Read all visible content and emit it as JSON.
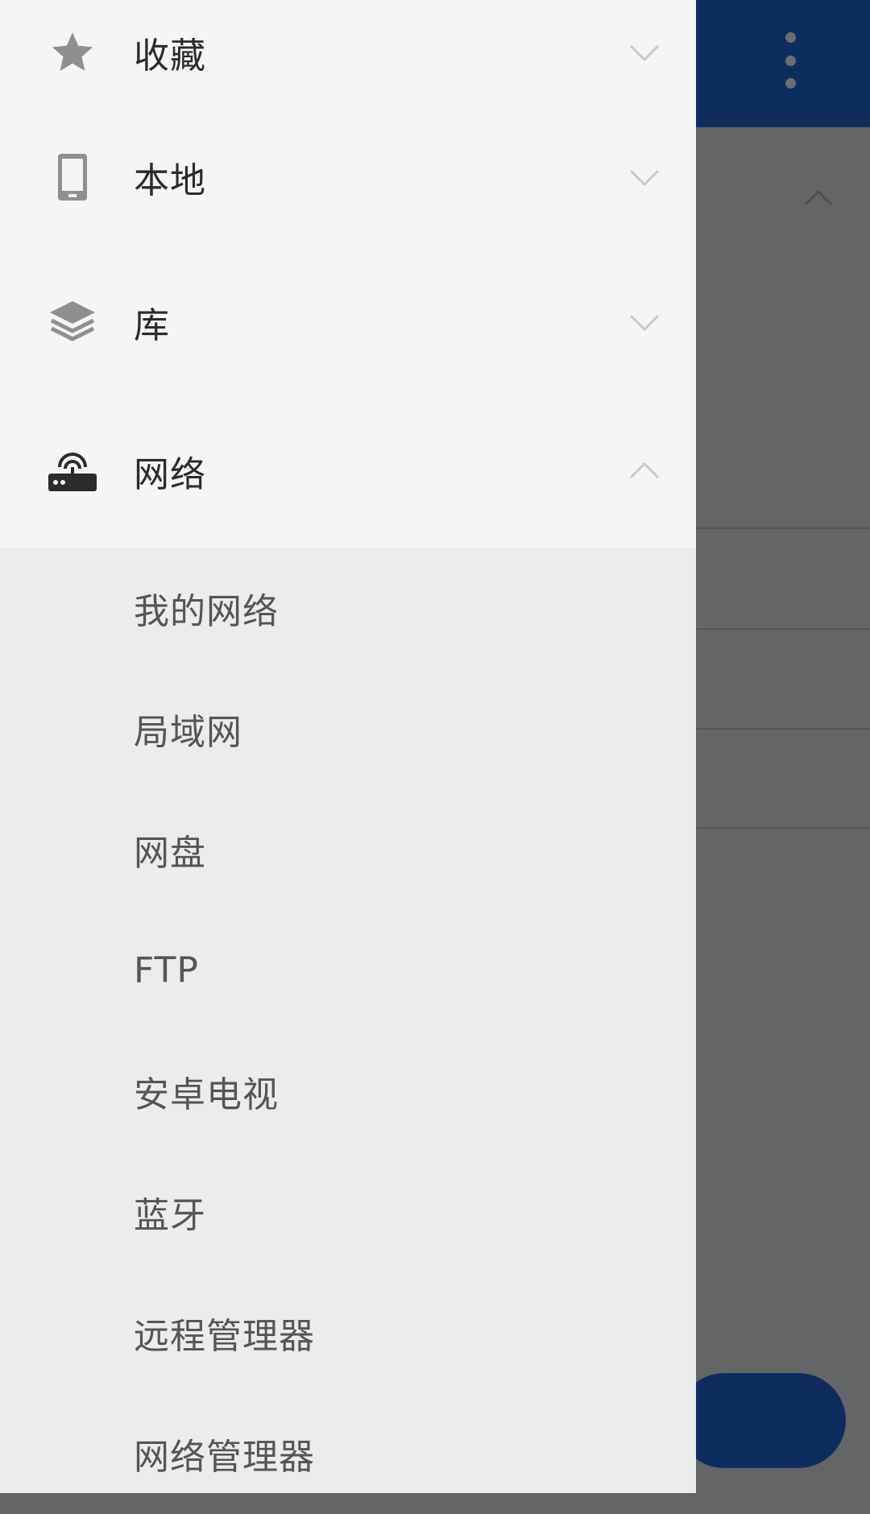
{
  "drawer": {
    "nav": [
      {
        "label": "收藏",
        "icon": "star-icon",
        "expanded": false
      },
      {
        "label": "本地",
        "icon": "phone-icon",
        "expanded": false
      },
      {
        "label": "库",
        "icon": "layers-icon",
        "expanded": false
      },
      {
        "label": "网络",
        "icon": "router-icon",
        "expanded": true
      }
    ],
    "network_items": [
      {
        "label": "我的网络"
      },
      {
        "label": "局域网"
      },
      {
        "label": "网盘"
      },
      {
        "label": "FTP"
      },
      {
        "label": "安卓电视"
      },
      {
        "label": "蓝牙"
      },
      {
        "label": "远程管理器"
      },
      {
        "label": "网络管理器"
      }
    ]
  },
  "colors": {
    "appbar": "#0f2d5c",
    "drawer_top": "#f4f5f7",
    "drawer_sub": "#ebecee",
    "scrim": "#646566"
  }
}
